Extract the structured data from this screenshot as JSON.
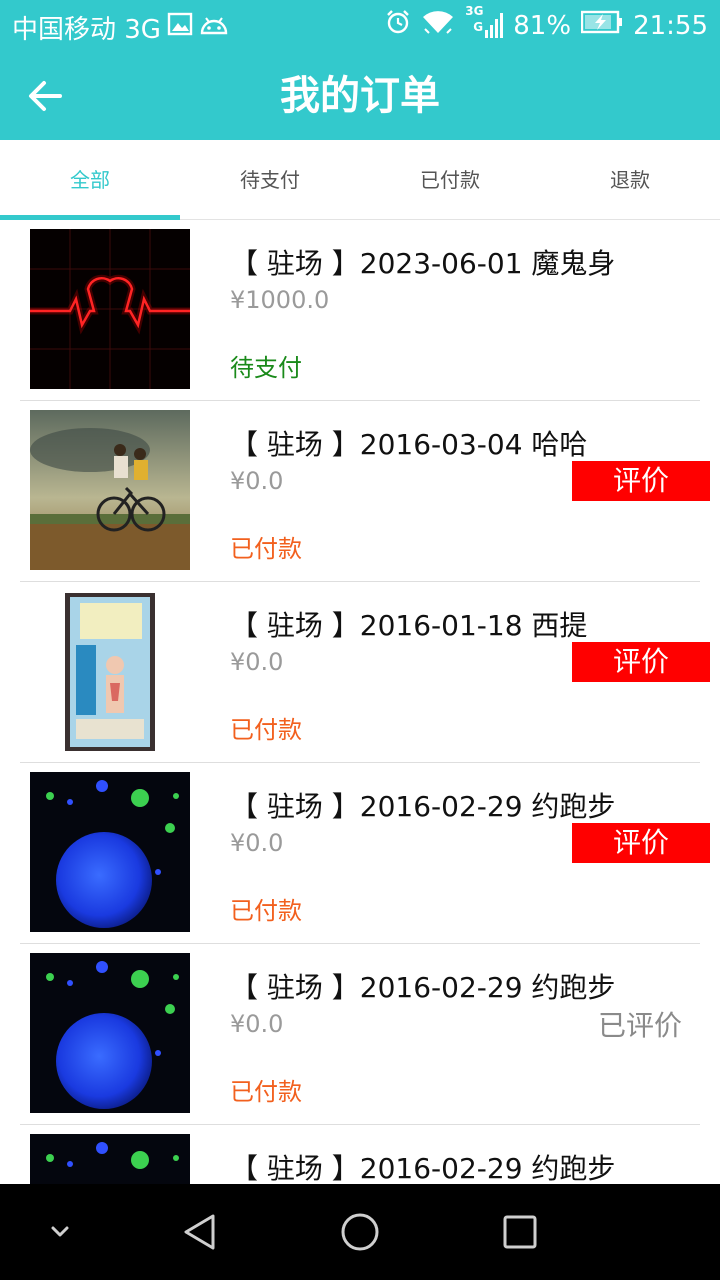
{
  "status_bar": {
    "carrier": "中国移动 3G",
    "network_badge_top": "3G",
    "network_badge_bottom": "G",
    "battery": "81%",
    "time": "21:55"
  },
  "header": {
    "title": "我的订单"
  },
  "tabs": [
    {
      "label": "全部",
      "active": true
    },
    {
      "label": "待支付",
      "active": false
    },
    {
      "label": "已付款",
      "active": false
    },
    {
      "label": "退款",
      "active": false
    }
  ],
  "orders": [
    {
      "name": "【 驻场 】2023-06-01 魔鬼身",
      "price": "¥1000.0",
      "status": "待支付",
      "action": "",
      "thumbnail": "heartbeat-image"
    },
    {
      "name": "【 驻场 】2016-03-04 哈哈",
      "price": "¥0.0",
      "status": "已付款",
      "action": "评价",
      "thumbnail": "bicycle-photo"
    },
    {
      "name": "【 驻场 】2016-01-18 西提",
      "price": "¥0.0",
      "status": "已付款",
      "action": "评价",
      "thumbnail": "anatomy-card-photo"
    },
    {
      "name": "【 驻场 】2016-02-29 约跑步",
      "price": "¥0.0",
      "status": "已付款",
      "action": "评价",
      "thumbnail": "blue-orb-photo"
    },
    {
      "name": "【 驻场 】2016-02-29 约跑步",
      "price": "¥0.0",
      "status": "已付款",
      "action": "已评价",
      "thumbnail": "blue-orb-photo"
    },
    {
      "name": "【 驻场 】2016-02-29 约跑步",
      "price": "",
      "status": "",
      "action": "",
      "thumbnail": "blue-orb-photo"
    }
  ],
  "colors": {
    "accent": "#33c9cc",
    "rate_button": "#ff0000",
    "pending": "#1a8a1a",
    "paid": "#f2601e"
  },
  "icons": {
    "back": "arrow-left-icon",
    "nav": [
      "chevron-down-icon",
      "back-triangle-icon",
      "home-circle-icon",
      "recents-square-icon"
    ]
  }
}
